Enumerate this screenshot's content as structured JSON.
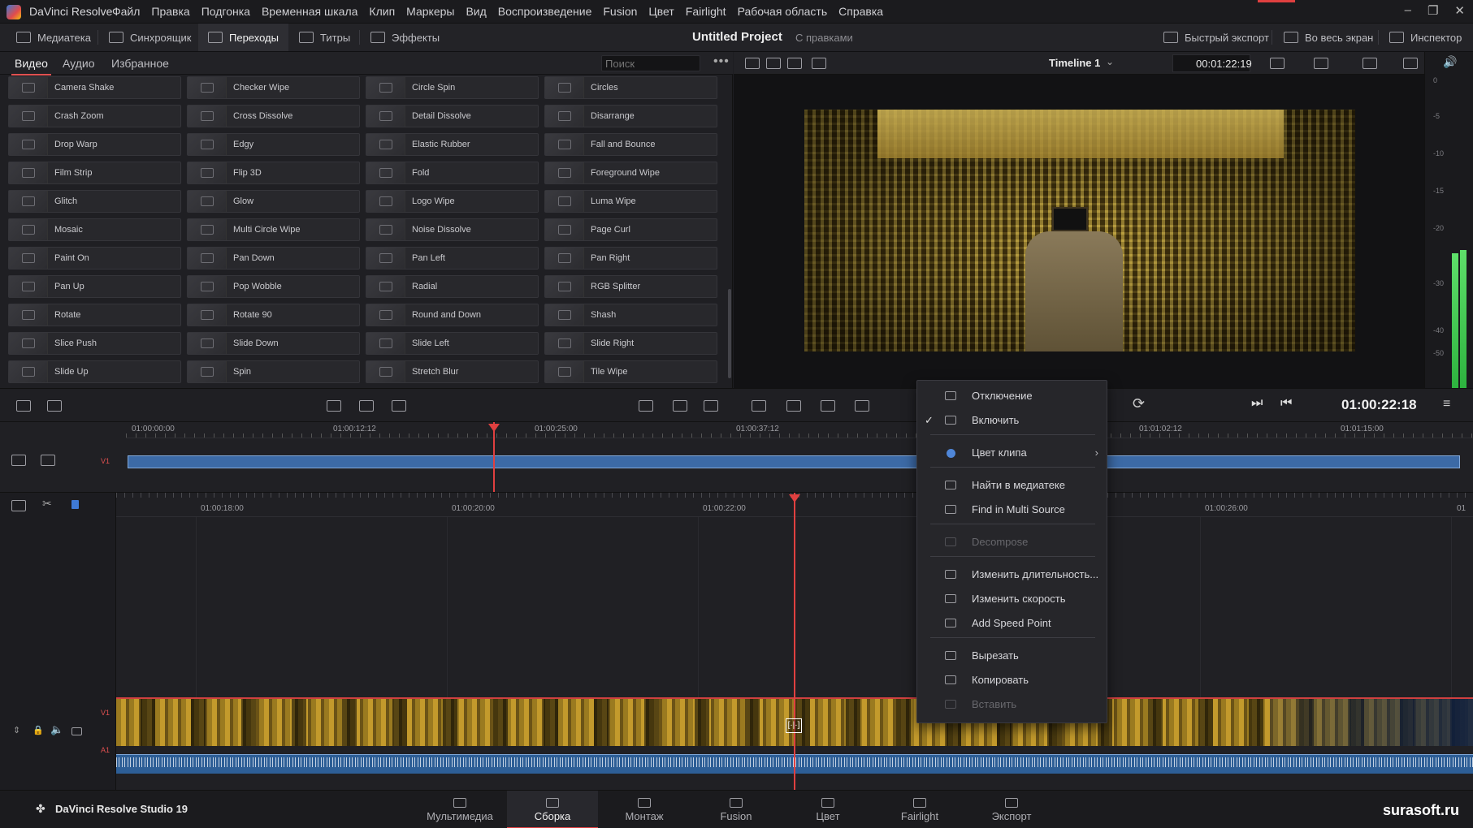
{
  "app": {
    "title": "DaVinci Resolve",
    "menu": [
      "Файл",
      "Правка",
      "Подгонка",
      "Временная шкала",
      "Клип",
      "Маркеры",
      "Вид",
      "Воспроизведение",
      "Fusion",
      "Цвет",
      "Fairlight",
      "Рабочая область",
      "Справка"
    ]
  },
  "toolbar": {
    "media_pool": "Медиатека",
    "sync": "Синхроящик",
    "transitions": "Переходы",
    "titles": "Титры",
    "effects": "Эффекты",
    "project_title": "Untitled Project",
    "project_status": "С правками",
    "quick_export": "Быстрый экспорт",
    "fullscreen": "Во весь экран",
    "inspector": "Инспектор"
  },
  "library": {
    "tabs": [
      "Видео",
      "Аудио",
      "Избранное"
    ],
    "search_placeholder": "Поиск",
    "items": [
      [
        "Camera Shake",
        "Checker Wipe",
        "Circle Spin",
        "Circles"
      ],
      [
        "Crash Zoom",
        "Cross Dissolve",
        "Detail Dissolve",
        "Disarrange"
      ],
      [
        "Drop Warp",
        "Edgy",
        "Elastic Rubber",
        "Fall and Bounce"
      ],
      [
        "Film Strip",
        "Flip 3D",
        "Fold",
        "Foreground Wipe"
      ],
      [
        "Glitch",
        "Glow",
        "Logo Wipe",
        "Luma Wipe"
      ],
      [
        "Mosaic",
        "Multi Circle Wipe",
        "Noise Dissolve",
        "Page Curl"
      ],
      [
        "Paint On",
        "Pan Down",
        "Pan Left",
        "Pan Right"
      ],
      [
        "Pan Up",
        "Pop Wobble",
        "Radial",
        "RGB Splitter"
      ],
      [
        "Rotate",
        "Rotate 90",
        "Round and Down",
        "Shash"
      ],
      [
        "Slice Push",
        "Slide Down",
        "Slide Left",
        "Slide Right"
      ],
      [
        "Slide Up",
        "Spin",
        "Stretch Blur",
        "Tile Wipe"
      ]
    ]
  },
  "viewer": {
    "timeline_name": "Timeline 1",
    "timecode": "00:01:22:19"
  },
  "meter": {
    "ticks": [
      "0",
      "-5",
      "-10",
      "-15",
      "-20",
      "-30",
      "-40",
      "-50"
    ]
  },
  "transport": {
    "timecode": "01:00:22:18"
  },
  "upper_timeline": {
    "ticks": [
      "01:00:00:00",
      "01:00:12:12",
      "01:00:25:00",
      "01:00:37:12",
      "01:01:02:12",
      "01:01:15:00"
    ],
    "track": "V1"
  },
  "lower_timeline": {
    "ticks": [
      "01:00:18:00",
      "01:00:20:00",
      "01:00:22:00",
      "01:00:26:00",
      "01"
    ],
    "video_track": "V1",
    "audio_track": "A1",
    "cursor_glyph": "[·|·]"
  },
  "context_menu": {
    "items": [
      {
        "label": "Отключение",
        "enabled": true,
        "checked": false
      },
      {
        "label": "Включить",
        "enabled": true,
        "checked": true
      },
      {
        "label": "Цвет клипа",
        "enabled": true,
        "submenu": true
      },
      {
        "label": "Найти в медиатеке",
        "enabled": true
      },
      {
        "label": "Find in Multi Source",
        "enabled": true
      },
      {
        "label": "Decompose",
        "enabled": false
      },
      {
        "label": "Изменить длительность...",
        "enabled": true
      },
      {
        "label": "Изменить скорость",
        "enabled": true
      },
      {
        "label": "Add Speed Point",
        "enabled": true
      },
      {
        "label": "Вырезать",
        "enabled": true
      },
      {
        "label": "Копировать",
        "enabled": true
      },
      {
        "label": "Вставить",
        "enabled": false
      }
    ],
    "check_glyph": "✓",
    "submenu_glyph": "›"
  },
  "pages": [
    "Мультимедиа",
    "Сборка",
    "Монтаж",
    "Fusion",
    "Цвет",
    "Fairlight",
    "Экспорт"
  ],
  "active_page": "Сборка",
  "brand": "DaVinci Resolve Studio 19",
  "watermark": "surasoft.ru",
  "colors": {
    "accent": "#e04040",
    "clip_blue": "#3c6aa6",
    "clip_color_dot": "#4f86d8"
  }
}
